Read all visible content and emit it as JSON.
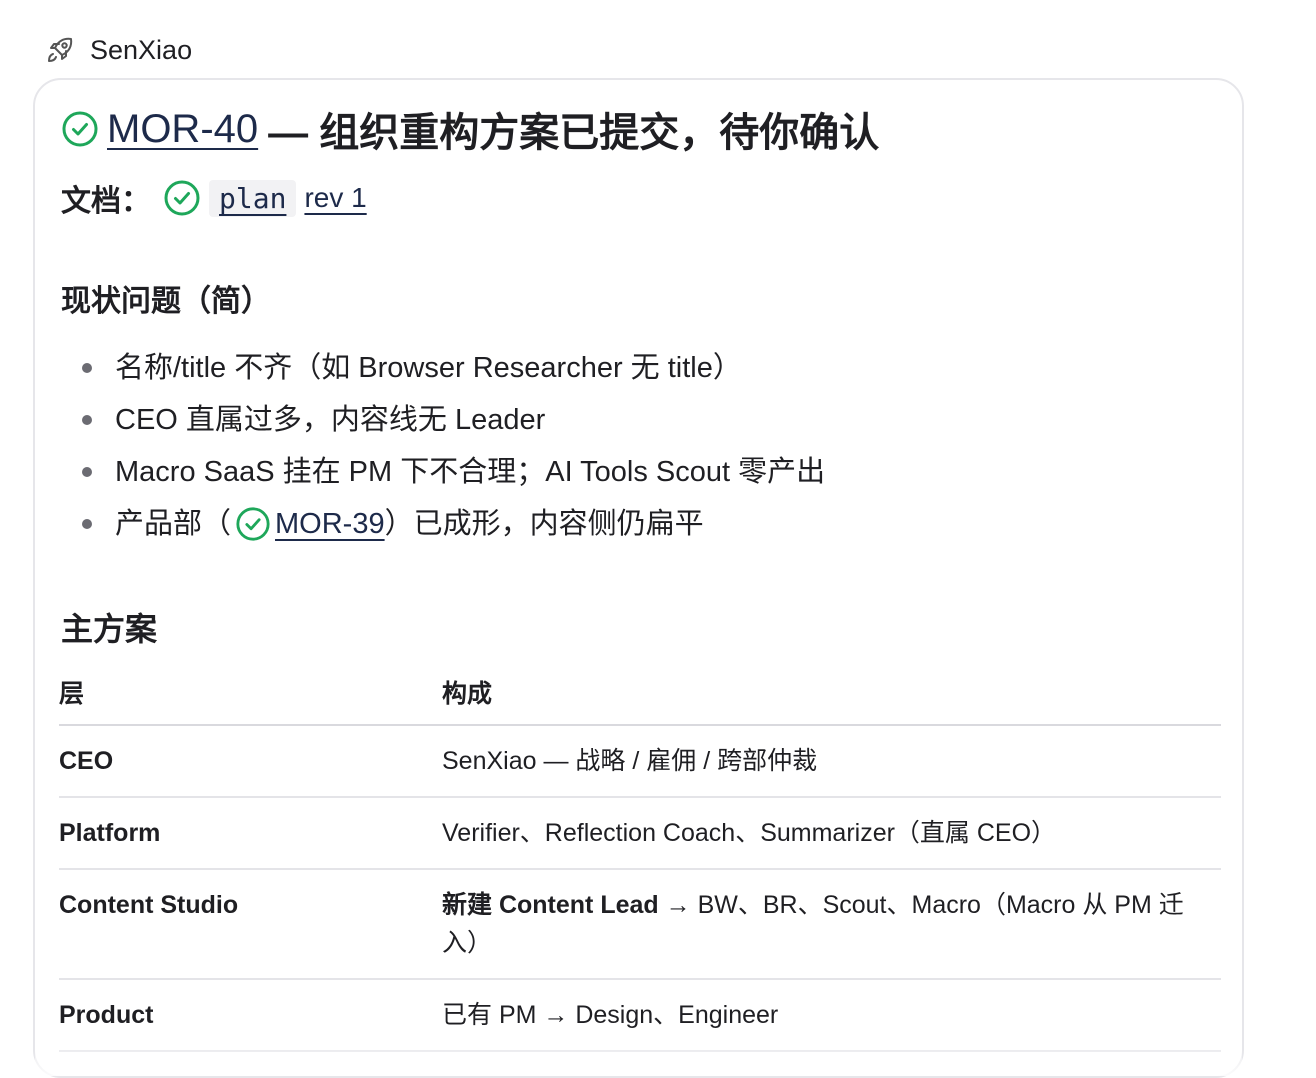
{
  "author": {
    "icon": "rocket-icon",
    "name": "SenXiao"
  },
  "colors": {
    "check_green": "#1ea75a",
    "link_navy": "#1d2a4a",
    "card_border": "#e6e6ea"
  },
  "message": {
    "title": {
      "issue_id": "MOR-40",
      "text": "— 组织重构方案已提交，待你确认"
    },
    "doc": {
      "label": "文档：",
      "chip": "plan",
      "rev": "rev 1"
    },
    "issues_heading": "现状问题（简）",
    "bullets": [
      "名称/title 不齐（如 Browser Researcher 无 title）",
      "CEO 直属过多，内容线无 Leader",
      "Macro SaaS 挂在 PM 下不合理；AI Tools Scout 零产出"
    ],
    "bullet4": {
      "prefix": "产品部（",
      "issue_id": "MOR-39",
      "suffix": "）已成形，内容侧仍扁平"
    },
    "plan_heading": "主方案",
    "table": {
      "headers": [
        "层",
        "构成"
      ],
      "rows": [
        {
          "layer": "CEO",
          "composition": "SenXiao — 战略 / 雇佣 / 跨部仲裁"
        },
        {
          "layer": "Platform",
          "composition": "Verifier、Reflection Coach、Summarizer（直属 CEO）"
        },
        {
          "layer": "Content Studio",
          "composition_bold": "新建 Content Lead",
          "composition": " → BW、BR、Scout、Macro（Macro 从 PM 迁入）"
        },
        {
          "layer": "Product",
          "composition": "已有 PM → Design、Engineer"
        }
      ]
    }
  }
}
